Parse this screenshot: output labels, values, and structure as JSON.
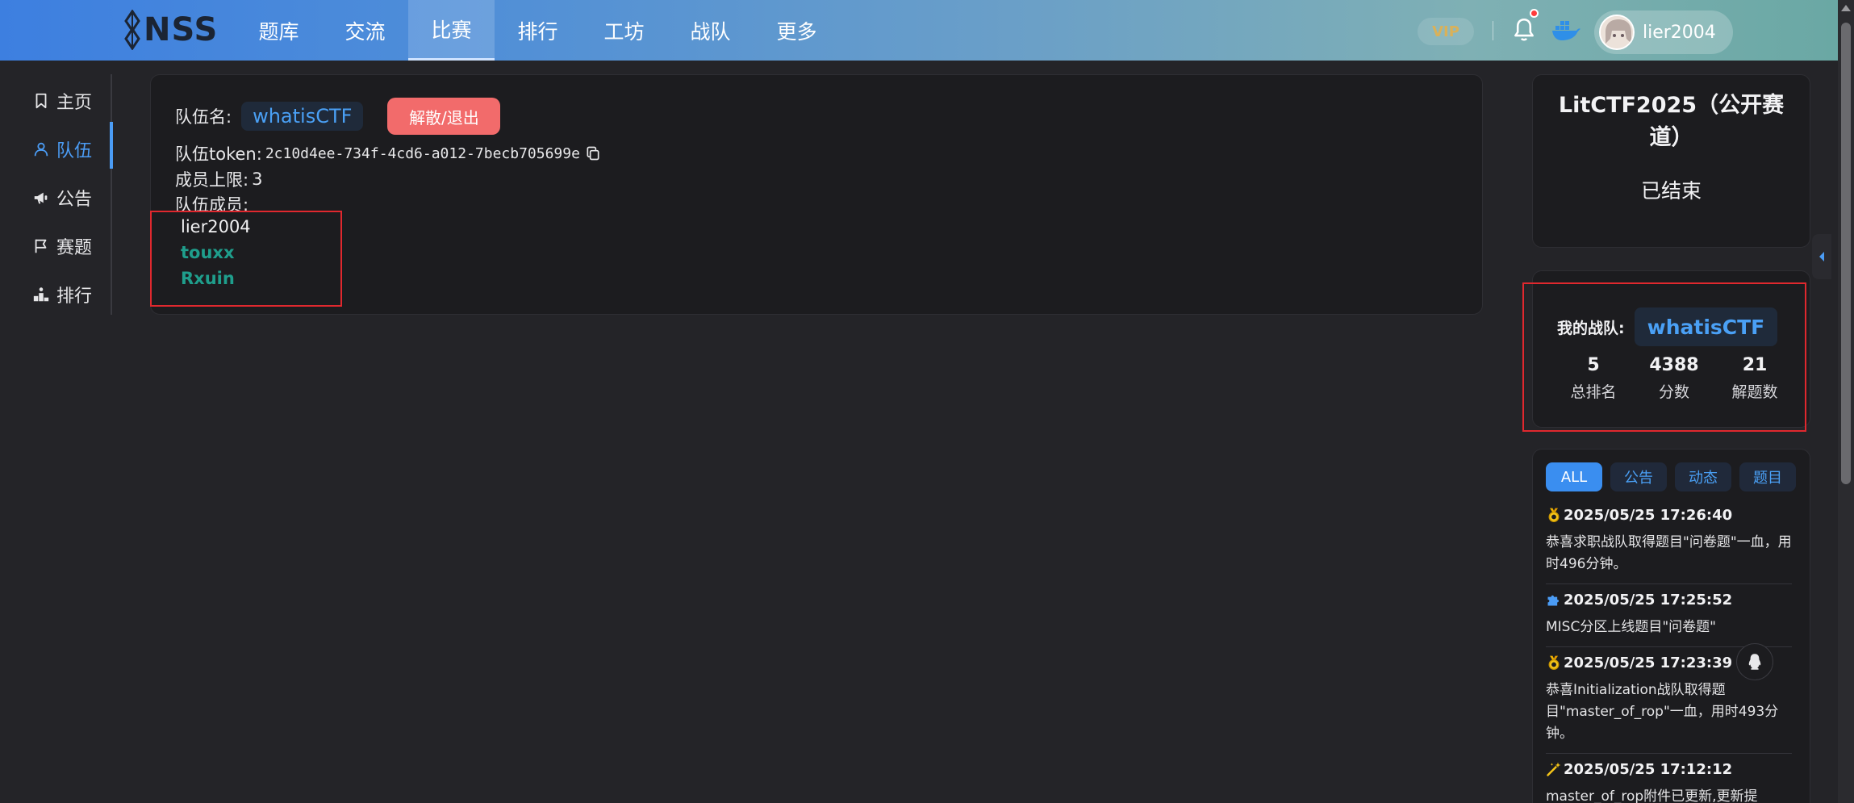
{
  "header": {
    "logo_text": "NSS",
    "nav": [
      "题库",
      "交流",
      "比赛",
      "排行",
      "工坊",
      "战队",
      "更多"
    ],
    "active_nav": "比赛",
    "vip_label": "VIP",
    "username": "lier2004"
  },
  "sidebar": {
    "items": [
      {
        "label": "主页",
        "icon": "bookmark-icon"
      },
      {
        "label": "队伍",
        "icon": "user-icon"
      },
      {
        "label": "公告",
        "icon": "megaphone-icon"
      },
      {
        "label": "赛题",
        "icon": "flag-icon"
      },
      {
        "label": "排行",
        "icon": "podium-icon"
      }
    ],
    "active": "队伍"
  },
  "team": {
    "name_label": "队伍名:",
    "name": "whatisCTF",
    "dissolve_label": "解散/退出",
    "token_label": "队伍token:",
    "token": "2c10d4ee-734f-4cd6-a012-7becb705699e",
    "limit_label": "成员上限:",
    "limit": "3",
    "members_label": "队伍成员:",
    "members": [
      "lier2004",
      "touxx",
      "Rxuin"
    ]
  },
  "contest": {
    "title": "LitCTF2025（公开赛道）",
    "status": "已结束"
  },
  "my_team": {
    "label": "我的战队:",
    "name": "whatisCTF",
    "stats": [
      {
        "value": "5",
        "label": "总排名"
      },
      {
        "value": "4388",
        "label": "分数"
      },
      {
        "value": "21",
        "label": "解题数"
      }
    ]
  },
  "feed": {
    "tabs": [
      "ALL",
      "公告",
      "动态",
      "题目"
    ],
    "active_tab": "ALL",
    "items": [
      {
        "icon": "medal-icon",
        "time": "2025/05/25 17:26:40",
        "text": "恭喜求职战队取得题目\"问卷题\"一血，用时496分钟。"
      },
      {
        "icon": "puzzle-icon",
        "time": "2025/05/25 17:25:52",
        "text": "MISC分区上线题目\"问卷题\""
      },
      {
        "icon": "medal-icon",
        "time": "2025/05/25 17:23:39",
        "text": "恭喜Initialization战队取得题目\"master_of_rop\"一血，用时493分钟。"
      },
      {
        "icon": "magic-wand-icon",
        "time": "2025/05/25 17:12:12",
        "text": "master_of_rop附件已更新,更新提"
      }
    ]
  },
  "colors": {
    "accent": "#4b9cf5",
    "danger": "#f26b6b",
    "member_color": "#1f9e8c",
    "card_bg": "#1c1c1f",
    "page_bg": "#242428"
  }
}
